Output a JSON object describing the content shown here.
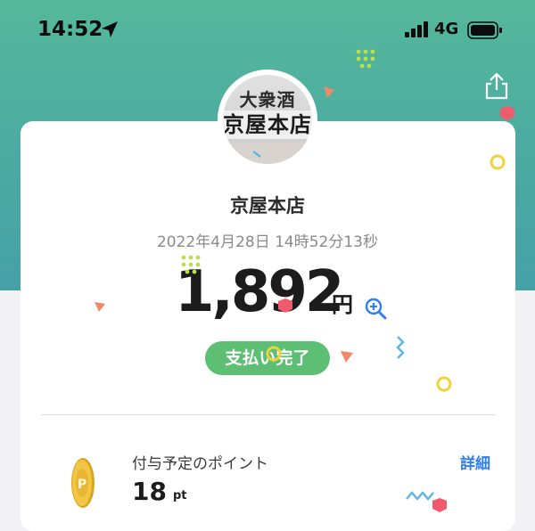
{
  "status_bar": {
    "time": "14:52",
    "network": "4G",
    "icons": [
      "location-arrow-icon",
      "signal-bars-icon",
      "battery-icon"
    ]
  },
  "header": {
    "share_icon": "share-icon"
  },
  "store": {
    "avatar_text_line1": "大衆酒",
    "avatar_text_line2": "京屋本店",
    "name": "京屋本店"
  },
  "payment": {
    "timestamp": "2022年4月28日 14時52分13秒",
    "amount": "1,892",
    "currency": "円",
    "zoom_icon": "zoom-in-icon",
    "status": "支払い完了"
  },
  "points": {
    "title": "付与予定のポイント",
    "detail_link": "詳細",
    "value": "18",
    "unit": "pt",
    "icon": "coin-icon"
  },
  "colors": {
    "header_top": "#55b89a",
    "header_bottom": "#45a1a6",
    "badge": "#5cbf74",
    "link": "#2f7fe8"
  }
}
